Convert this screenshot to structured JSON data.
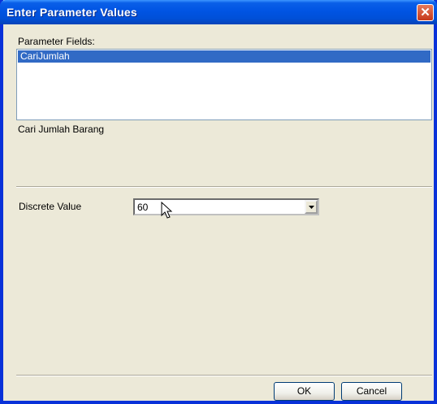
{
  "window": {
    "title": "Enter Parameter Values",
    "close_glyph": "✕"
  },
  "parameter_fields": {
    "label": "Parameter Fields:",
    "items": [
      "CariJumlah"
    ],
    "selected": "CariJumlah"
  },
  "prompt_text": "Cari Jumlah Barang",
  "discrete_value": {
    "label": "Discrete Value",
    "value": "60"
  },
  "buttons": {
    "ok": "OK",
    "cancel": "Cancel"
  },
  "icons": {
    "close": "close-icon",
    "dropdown": "chevron-down-icon",
    "cursor": "mouse-pointer-icon"
  },
  "colors": {
    "title_bar": "#0054e3",
    "selection": "#316ac5",
    "dialog_bg": "#ece9d8",
    "close_button": "#c5381a"
  }
}
